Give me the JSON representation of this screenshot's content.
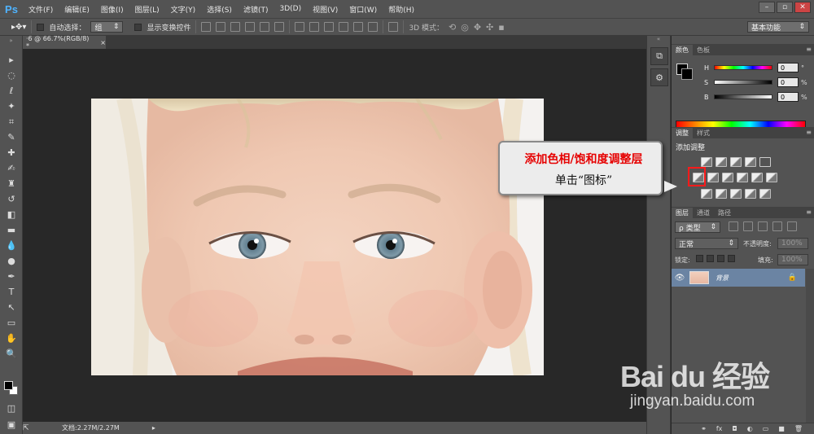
{
  "menubar": {
    "logo": "Ps",
    "items": [
      "文件(F)",
      "编辑(E)",
      "图像(I)",
      "图层(L)",
      "文字(Y)",
      "选择(S)",
      "滤镜(T)",
      "3D(D)",
      "视图(V)",
      "窗口(W)",
      "帮助(H)"
    ],
    "window_controls": [
      "–",
      "▫",
      "✕"
    ]
  },
  "options": {
    "auto_select_label": "自动选择：",
    "auto_select_value": "组",
    "show_transform_label": "显示变换控件",
    "mode_3d_label": "3D 模式：",
    "workspace": "基本功能"
  },
  "document": {
    "tab_label": "·6 @ 66.7%(RGB/8) *",
    "tab_close": "×",
    "status": "文档:2.27M/2.27M"
  },
  "color_panel": {
    "tabs": [
      "颜色",
      "色板"
    ],
    "sliders": [
      {
        "label": "H",
        "value": "0",
        "unit": "°",
        "gradient": "linear-gradient(to right,#f00,#ff0,#0f0,#0ff,#00f,#f0f,#f00)"
      },
      {
        "label": "S",
        "value": "0",
        "unit": "%",
        "gradient": "linear-gradient(to right,#fff,#000)"
      },
      {
        "label": "B",
        "value": "0",
        "unit": "%",
        "gradient": "linear-gradient(to right,#000,#fff)"
      }
    ]
  },
  "adjustments_panel": {
    "tabs": [
      "调整",
      "样式"
    ],
    "title": "添加调整"
  },
  "layers_panel": {
    "tabs": [
      "图层",
      "通道",
      "路径"
    ],
    "filter_kind": "ρ 类型",
    "blend_mode": "正常",
    "opacity_label": "不透明度:",
    "opacity_value": "100%",
    "lock_label": "锁定:",
    "fill_label": "填充:",
    "fill_value": "100%",
    "layer_name": "背景",
    "footer_icons": [
      "⚭",
      "fx",
      "◘",
      "◐",
      "▭",
      "■",
      "🗑"
    ]
  },
  "callout": {
    "title": "添加色相/饱和度调整层",
    "subtitle": "单击“图标”"
  },
  "watermark": {
    "brand": "Bai du 经验",
    "url": "jingyan.baidu.com"
  },
  "colors": {
    "chrome": "#535353",
    "canvas_bg": "#282828",
    "layer_selected": "#6b84a3",
    "callout_red": "#e60000"
  }
}
